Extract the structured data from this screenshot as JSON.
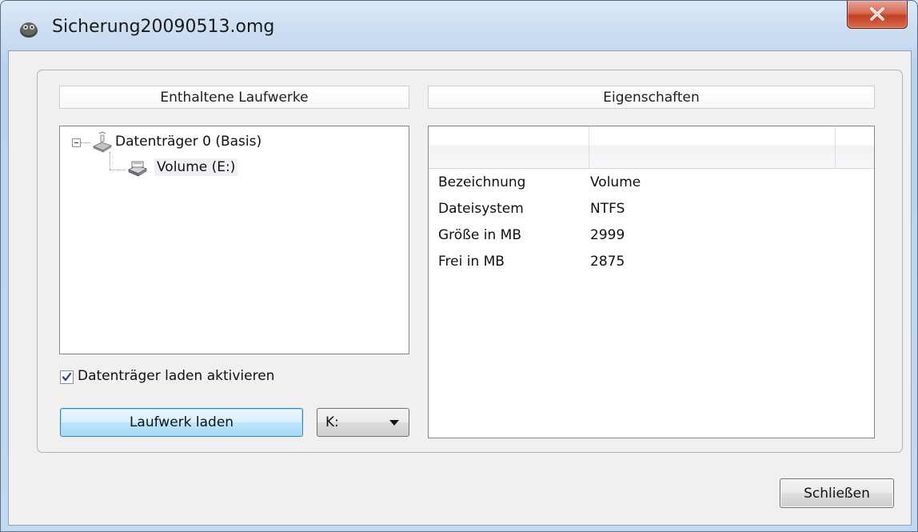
{
  "window": {
    "title": "Sicherung20090513.omg",
    "icon": "app-icon"
  },
  "left": {
    "header": "Enthaltene Laufwerke",
    "tree": [
      {
        "label": "Datenträger 0 (Basis)",
        "icon": "disk-icon",
        "expanded": true
      },
      {
        "label": "Volume (E:)",
        "icon": "volume-icon",
        "selected": true
      }
    ],
    "checkbox": {
      "label": "Datenträger laden aktivieren",
      "checked": true
    },
    "load_button": "Laufwerk laden",
    "drive_select": {
      "value": "K:"
    }
  },
  "right": {
    "header": "Eigenschaften",
    "properties": [
      {
        "key": "Bezeichnung",
        "value": "Volume"
      },
      {
        "key": "Dateisystem",
        "value": "NTFS"
      },
      {
        "key": "Größe in MB",
        "value": "2999"
      },
      {
        "key": "Frei in MB",
        "value": "2875"
      }
    ]
  },
  "footer": {
    "close_button": "Schließen"
  }
}
